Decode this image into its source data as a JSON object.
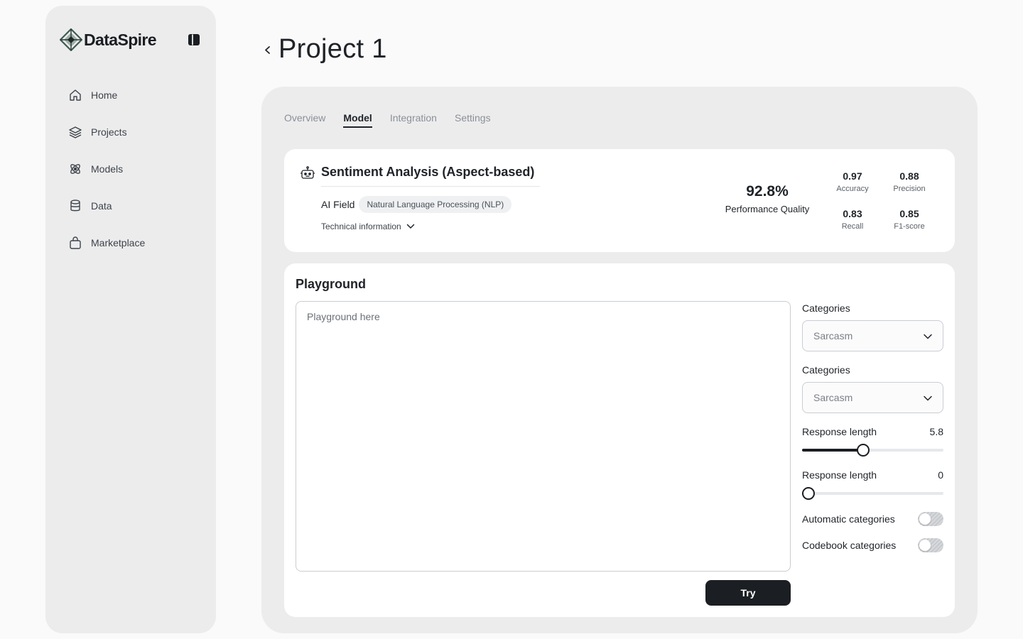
{
  "brand": {
    "name": "DataSpire"
  },
  "sidebar": {
    "items": [
      {
        "label": "Home",
        "icon": "home-icon"
      },
      {
        "label": "Projects",
        "icon": "layers-icon"
      },
      {
        "label": "Models",
        "icon": "atom-icon"
      },
      {
        "label": "Data",
        "icon": "database-icon"
      },
      {
        "label": "Marketplace",
        "icon": "shopping-bag-icon"
      }
    ]
  },
  "header": {
    "title": "Project 1"
  },
  "tabs": [
    {
      "label": "Overview",
      "active": false
    },
    {
      "label": "Model",
      "active": true
    },
    {
      "label": "Integration",
      "active": false
    },
    {
      "label": "Settings",
      "active": false
    }
  ],
  "model": {
    "title": "Sentiment Analysis (Aspect-based)",
    "ai_field_label": "AI Field",
    "ai_field_value": "Natural Language Processing (NLP)",
    "tech_info_label": "Technical information",
    "performance_value": "92.8%",
    "performance_label": "Performance Quality",
    "metrics": {
      "accuracy": {
        "value": "0.97",
        "label": "Accuracy"
      },
      "precision": {
        "value": "0.88",
        "label": "Precision"
      },
      "recall": {
        "value": "0.83",
        "label": "Recall"
      },
      "f1": {
        "value": "0.85",
        "label": "F1-score"
      }
    }
  },
  "playground": {
    "title": "Playground",
    "placeholder": "Playground here",
    "try_label": "Try",
    "category1": {
      "label": "Categories",
      "value": "Sarcasm"
    },
    "category2": {
      "label": "Categories",
      "value": "Sarcasm"
    },
    "slider1": {
      "label": "Response length",
      "value": "5.8",
      "fraction": 0.43
    },
    "slider2": {
      "label": "Response length",
      "value": "0",
      "fraction": 0.0
    },
    "toggle1": {
      "label": "Automatic categories",
      "on": false
    },
    "toggle2": {
      "label": "Codebook categories",
      "on": false
    }
  },
  "colors": {
    "accent": "#1b1e22",
    "sidebar_bg": "#ececed",
    "panel_bg": "#ececed",
    "card_bg": "#ffffff"
  }
}
